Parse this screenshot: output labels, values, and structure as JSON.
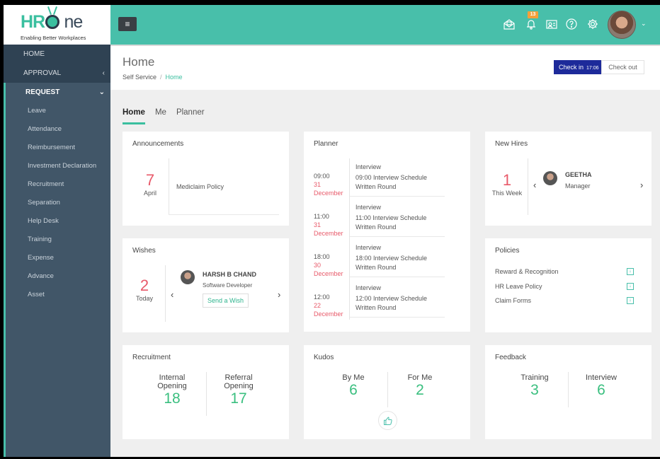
{
  "brand": {
    "logo_text_a": "HR-",
    "logo_text_b": "ne",
    "tagline": "Enabling Better Workplaces"
  },
  "topbar": {
    "menu_icon": "hamburger-icon",
    "icons": [
      "mail-icon",
      "bell-icon",
      "id-card-icon",
      "help-icon",
      "gear-icon"
    ],
    "notification_count": "13",
    "avatar_caret": "⌄"
  },
  "sidebar": {
    "home": "HOME",
    "approval": "APPROVAL",
    "request": "REQUEST",
    "approval_chevron": "‹",
    "request_chevron": "⌄",
    "sub_items": [
      "Leave",
      "Attendance",
      "Reimbursement",
      "Investment Declaration",
      "Recruitment",
      "Separation",
      "Help Desk",
      "Training",
      "Expense",
      "Advance",
      "Asset"
    ]
  },
  "header": {
    "title": "Home",
    "breadcrumb": [
      "Self Service",
      "Home"
    ],
    "breadcrumb_sep": "/",
    "checkin_label": "Check in",
    "checkin_time": "17:06",
    "checkout_label": "Check out"
  },
  "tabs": [
    "Home",
    "Me",
    "Planner"
  ],
  "announcements": {
    "title": "Announcements",
    "day": "7",
    "month": "April",
    "item": "Mediclaim Policy"
  },
  "planner": {
    "title": "Planner",
    "events": [
      {
        "time": "09:00",
        "day": "31",
        "month": "December",
        "type": "Interview",
        "line1": "09:00 Interview Schedule",
        "line2": "Written Round"
      },
      {
        "time": "11:00",
        "day": "31",
        "month": "December",
        "type": "Interview",
        "line1": "11:00 Interview Schedule",
        "line2": "Written Round"
      },
      {
        "time": "18:00",
        "day": "30",
        "month": "December",
        "type": "Interview",
        "line1": "18:00 Interview Schedule",
        "line2": "Written Round"
      },
      {
        "time": "12:00",
        "day": "22",
        "month": "December",
        "type": "Interview",
        "line1": "12:00 Interview Schedule",
        "line2": "Written Round"
      }
    ]
  },
  "new_hires": {
    "title": "New Hires",
    "count": "1",
    "period": "This Week",
    "name": "GEETHA",
    "role": "Manager",
    "prev": "‹",
    "next": "›"
  },
  "wishes": {
    "title": "Wishes",
    "count": "2",
    "period": "Today",
    "name": "HARSH B CHAND",
    "role": "Software Developer",
    "button": "Send a Wish",
    "prev": "‹",
    "next": "›"
  },
  "policies": {
    "title": "Policies",
    "items": [
      "Reward & Recognition",
      "HR Leave Policy",
      "Claim Forms"
    ],
    "download_glyph": "↓"
  },
  "recruitment": {
    "title": "Recruitment",
    "stats": [
      {
        "label1": "Internal",
        "label2": "Opening",
        "value": "18"
      },
      {
        "label1": "Referral",
        "label2": "Opening",
        "value": "17"
      }
    ]
  },
  "kudos": {
    "title": "Kudos",
    "stats": [
      {
        "label": "By Me",
        "value": "6"
      },
      {
        "label": "For Me",
        "value": "2"
      }
    ],
    "thumb": "👍"
  },
  "feedback": {
    "title": "Feedback",
    "stats": [
      {
        "label": "Training",
        "value": "3"
      },
      {
        "label": "Interview",
        "value": "6"
      }
    ]
  }
}
